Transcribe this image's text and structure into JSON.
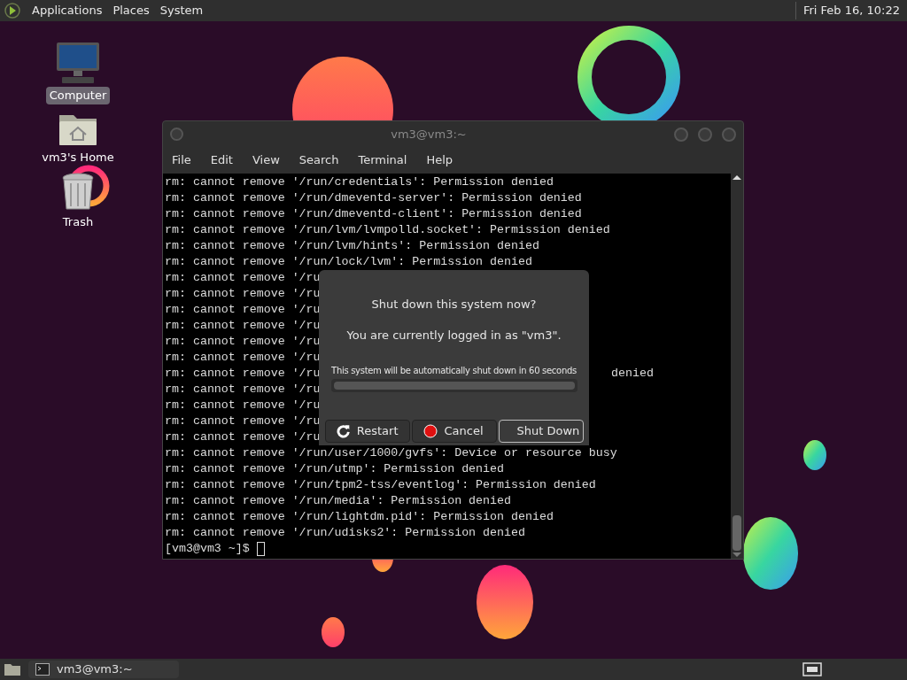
{
  "top_panel": {
    "menus": [
      "Applications",
      "Places",
      "System"
    ],
    "clock": "Fri Feb 16, 10:22"
  },
  "desktop_icons": [
    {
      "kind": "computer",
      "label": "Computer",
      "selected": true
    },
    {
      "kind": "home",
      "label": "vm3's Home",
      "selected": false
    },
    {
      "kind": "trash",
      "label": "Trash",
      "selected": false
    }
  ],
  "terminal": {
    "title": "vm3@vm3:~",
    "menu": [
      "File",
      "Edit",
      "View",
      "Search",
      "Terminal",
      "Help"
    ],
    "lines": [
      {
        "text": "rm: cannot remove '/run/credentials': Permission denied"
      },
      {
        "text": "rm: cannot remove '/run/dmeventd-server': Permission denied"
      },
      {
        "text": "rm: cannot remove '/run/dmeventd-client': Permission denied"
      },
      {
        "text": "rm: cannot remove '/run/lvm/lvmpolld.socket': Permission denied"
      },
      {
        "text": "rm: cannot remove '/run/lvm/hints': Permission denied"
      },
      {
        "text": "rm: cannot remove '/run/lock/lvm': Permission denied"
      },
      {
        "text": "rm: cannot remove '/ru"
      },
      {
        "text": "rm: cannot remove '/ru"
      },
      {
        "text": "rm: cannot remove '/ru"
      },
      {
        "text": "rm: cannot remove '/ru"
      },
      {
        "text": "rm: cannot remove '/ru"
      },
      {
        "text": "rm: cannot remove '/ru"
      },
      {
        "text": "rm: cannot remove '/ru",
        "tail": "denied"
      },
      {
        "text": "rm: cannot remove '/ru"
      },
      {
        "text": "rm: cannot remove '/ru"
      },
      {
        "text": "rm: cannot remove '/ru"
      },
      {
        "text": "rm: cannot remove '/ru"
      },
      {
        "text": "rm: cannot remove '/run/user/1000/gvfs': Device or resource busy"
      },
      {
        "text": "rm: cannot remove '/run/utmp': Permission denied"
      },
      {
        "text": "rm: cannot remove '/run/tpm2-tss/eventlog': Permission denied"
      },
      {
        "text": "rm: cannot remove '/run/media': Permission denied"
      },
      {
        "text": "rm: cannot remove '/run/lightdm.pid': Permission denied"
      },
      {
        "text": "rm: cannot remove '/run/udisks2': Permission denied"
      }
    ],
    "prompt": "[vm3@vm3 ~]$"
  },
  "dialog": {
    "title": "Shut down this system now?",
    "message": "You are currently logged in as \"vm3\".",
    "countdown": "This system will be automatically shut down in 60 seconds",
    "progress": {
      "level": 1
    },
    "buttons": [
      {
        "kind": "restart",
        "label": "Restart",
        "selected": false
      },
      {
        "kind": "cancel",
        "label": "Cancel",
        "selected": false
      },
      {
        "kind": "shutdown",
        "label": "Shut Down",
        "selected": true
      }
    ]
  },
  "bottom_panel": {
    "tasks": [
      {
        "label": "vm3@vm3:~"
      }
    ]
  }
}
